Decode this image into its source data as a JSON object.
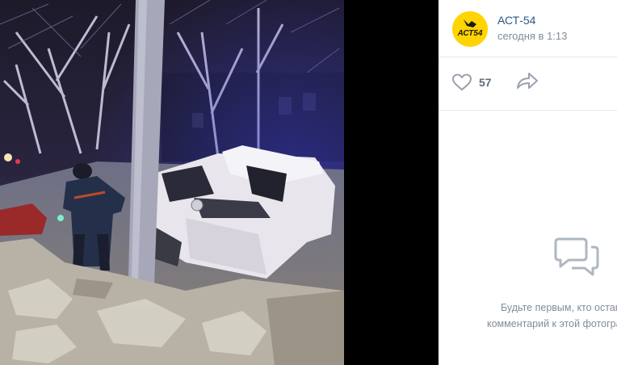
{
  "post": {
    "author": "АСТ-54",
    "time": "сегодня в 1:13",
    "avatar_text": "АСТ-54"
  },
  "actions": {
    "likes": "57",
    "like_icon": "heart-icon",
    "share_icon": "share-arrow-icon"
  },
  "comments": {
    "icon": "comment-bubble-icon",
    "empty_line1": "Будьте первым, кто оставит",
    "empty_line2": "комментарий к этой фотографии"
  },
  "colors": {
    "link": "#2a5885",
    "muted": "#818c99",
    "avatar_bg": "#ffd400",
    "viewer_bg": "#000000"
  }
}
